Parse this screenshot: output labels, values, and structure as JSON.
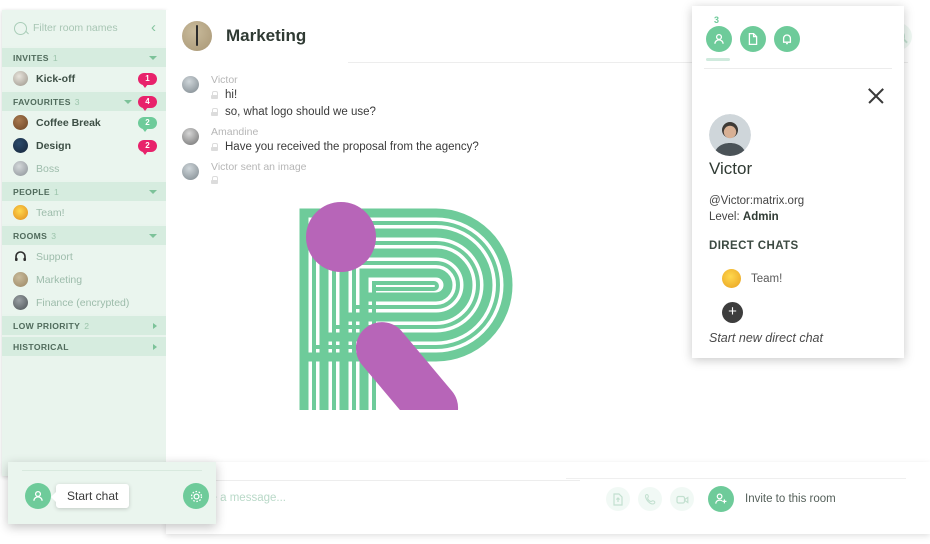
{
  "sidebar": {
    "filter": {
      "placeholder": "Filter room names",
      "search_icon": "search-icon",
      "collapse_icon": "chevron-left-icon"
    },
    "sections": [
      {
        "label": "INVITES",
        "count": "1",
        "expanded": true,
        "badge": "",
        "rooms": [
          {
            "name": "Kick-off",
            "badge": "1",
            "badge_color": "pink",
            "unread": true,
            "avatar": "kickoff-avatar"
          }
        ]
      },
      {
        "label": "FAVOURITES",
        "count": "3",
        "expanded": true,
        "badge": "4",
        "rooms": [
          {
            "name": "Coffee Break",
            "badge": "2",
            "badge_color": "green",
            "unread": true,
            "avatar": "coffee-avatar"
          },
          {
            "name": "Design",
            "badge": "2",
            "badge_color": "pink",
            "unread": true,
            "avatar": "design-avatar"
          },
          {
            "name": "Boss",
            "badge": "",
            "badge_color": "",
            "unread": false,
            "avatar": "boss-avatar"
          }
        ]
      },
      {
        "label": "PEOPLE",
        "count": "1",
        "expanded": true,
        "badge": "",
        "rooms": [
          {
            "name": "Team!",
            "badge": "",
            "badge_color": "",
            "unread": false,
            "avatar": "team-avatar"
          }
        ]
      },
      {
        "label": "ROOMS",
        "count": "3",
        "expanded": true,
        "badge": "",
        "rooms": [
          {
            "name": "Support",
            "badge": "",
            "badge_color": "",
            "unread": false,
            "avatar": "headset-avatar"
          },
          {
            "name": "Marketing",
            "badge": "",
            "badge_color": "",
            "unread": false,
            "avatar": "marketing-avatar"
          },
          {
            "name": "Finance (encrypted)",
            "badge": "",
            "badge_color": "",
            "unread": false,
            "avatar": "finance-avatar"
          }
        ]
      },
      {
        "label": "LOW PRIORITY",
        "count": "2",
        "expanded": false,
        "badge": "",
        "rooms": []
      },
      {
        "label": "HISTORICAL",
        "count": "",
        "expanded": false,
        "badge": "",
        "rooms": []
      }
    ]
  },
  "header": {
    "room_name": "Marketing",
    "avatar": "marketing-room-avatar",
    "settings_icon": "room-settings-icon",
    "search_icon": "search-icon"
  },
  "messages": [
    {
      "sender": "Victor",
      "avatar": "victor-avatar",
      "lines": [
        {
          "text": "hi!",
          "encrypted": true
        },
        {
          "text": "so, what logo should we use?",
          "encrypted": true
        }
      ]
    },
    {
      "sender": "Amandine",
      "avatar": "amandine-avatar",
      "lines": [
        {
          "text": "Have you received the proposal from the agency?",
          "encrypted": true
        }
      ]
    },
    {
      "sender": "Victor sent an image",
      "avatar": "victor-avatar",
      "lines": [
        {
          "text": "",
          "encrypted": true
        }
      ]
    }
  ],
  "logo_image": {
    "letter": "R",
    "stripe_color": "#6ecb9a",
    "accent_color": "#b濃"
  },
  "composer": {
    "placeholder": "Type a message...",
    "icons": [
      "upload-file-icon",
      "voice-call-icon",
      "video-call-icon"
    ],
    "invite_label": "Invite to this room",
    "invite_icon": "add-person-icon"
  },
  "right_panel": {
    "member_count": "3",
    "tabs": [
      "members-tab-icon",
      "files-tab-icon",
      "notifications-tab-icon"
    ],
    "close_icon": "close-icon",
    "avatar": "victor-profile-avatar",
    "name": "Victor",
    "matrix_id": "@Victor:matrix.org",
    "level_label": "Level:",
    "level_value": "Admin",
    "direct_chats_title": "DIRECT CHATS",
    "direct_chats": [
      {
        "name": "Team!",
        "avatar": "team-avatar"
      }
    ],
    "new_chat_icon": "plus-icon",
    "new_chat_label": "Start new direct chat"
  },
  "bottom_left": {
    "person_icon": "person-icon",
    "gear_icon": "settings-gear-icon",
    "tooltip": "Start chat"
  },
  "colors": {
    "green": "#6ecb9a",
    "green_light": "#eaf5ee",
    "green_section": "#d6ecdf",
    "pink": "#e8226b",
    "purple": "#b765b8",
    "text_dark": "#2f3a33",
    "text_muted": "#b6b6b6"
  }
}
